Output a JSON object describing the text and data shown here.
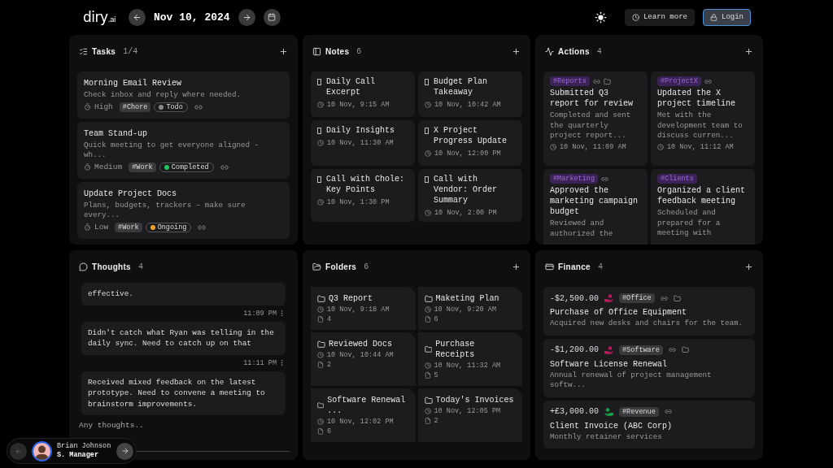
{
  "header": {
    "logo": "diry",
    "logo_suffix": ".ai",
    "date": "Nov 10, 2024",
    "learn_more": "Learn more",
    "login": "Login"
  },
  "tasks": {
    "title": "Tasks",
    "count": "1/4",
    "items": [
      {
        "title": "Morning Email Review",
        "description": "Check inbox and reply where needed.",
        "priority": "High",
        "tag": "#Chore",
        "status": "Todo",
        "color": "#8a8a8a"
      },
      {
        "title": "Team Stand-up",
        "description": "Quick meeting to get everyone aligned - wh...",
        "priority": "Medium",
        "tag": "#Work",
        "status": "Completed",
        "color": "#22c55e"
      },
      {
        "title": "Update Project Docs",
        "description": "Plans, budgets, trackers – make sure every...",
        "priority": "Low",
        "tag": "#Work",
        "status": "Ongoing",
        "color": "#f5a524"
      }
    ]
  },
  "notes": {
    "title": "Notes",
    "count": "6",
    "items": [
      {
        "title": "Daily Call Excerpt",
        "time": "10 Nov, 9:15 AM"
      },
      {
        "title": "Budget Plan Takeaway",
        "time": "10 Nov, 10:42 AM"
      },
      {
        "title": "Daily Insights",
        "time": "10 Nov, 11:30 AM"
      },
      {
        "title": "X Project Progress Update",
        "time": "10 Nov, 12:00 PM"
      },
      {
        "title": "Call with Chole: Key Points",
        "time": "10 Nov, 1:30 PM"
      },
      {
        "title": "Call with Vendor: Order Summary",
        "time": "10 Nov, 2:00 PM"
      }
    ]
  },
  "actions": {
    "title": "Actions",
    "count": "4",
    "items": [
      {
        "tag": "#Reports",
        "link": true,
        "folder": true,
        "title": "Submitted Q3 report for review",
        "description": "Completed and sent the quarterly project report...",
        "time": "10 Nov, 11:09 AM"
      },
      {
        "tag": "#ProjectX",
        "link": true,
        "folder": false,
        "title": "Updated the X project timeline",
        "description": "Met with the development team to discuss curren...",
        "time": "10 Nov, 11:12 AM"
      },
      {
        "tag": "#Marketing",
        "link": true,
        "folder": false,
        "title": "Approved the marketing campaign budget",
        "description": "Reviewed and authorized the"
      },
      {
        "tag": "#Clients",
        "link": false,
        "folder": false,
        "title": "Organized a client feedback meeting",
        "description": "Scheduled and prepared for a meeting with"
      }
    ]
  },
  "thoughts": {
    "title": "Thoughts",
    "count": "4",
    "items": [
      {
        "text": "effective.",
        "time": "11:09 PM"
      },
      {
        "text": "Didn't catch what Ryan was telling in the daily sync. Need to catch up on that",
        "time": "11:11 PM"
      },
      {
        "text": "Received mixed feedback on the latest prototype. Need to convene a meeting to brainstorm improvements."
      }
    ],
    "placeholder": "Any thoughts.."
  },
  "folders": {
    "title": "Folders",
    "count": "6",
    "items": [
      {
        "name": "Q3 Report",
        "time": "10 Nov, 9:18 AM",
        "files": "4"
      },
      {
        "name": "Maketing Plan",
        "time": "10 Nov, 9:20 AM",
        "files": "6"
      },
      {
        "name": "Reviewed Docs",
        "time": "10 Nov, 10:44 AM",
        "files": "2"
      },
      {
        "name": "Purchase Receipts",
        "time": "10 Nov, 11:32 AM",
        "files": "5"
      },
      {
        "name": "Software Renewal ...",
        "time": "10 Nov, 12:02 PM",
        "files": "6"
      },
      {
        "name": "Today's Invoices",
        "time": "10 Nov, 12:05 PM",
        "files": "2"
      }
    ]
  },
  "finance": {
    "title": "Finance",
    "count": "4",
    "items": [
      {
        "amount": "-$2,500.00",
        "kind": "expense",
        "color": "#be185d",
        "tag": "#Office",
        "folder": true,
        "title": "Purchase of Office Equipment",
        "description": "Acquired new desks and chairs for the team."
      },
      {
        "amount": "-$1,200.00",
        "kind": "expense",
        "color": "#be185d",
        "tag": "#Software",
        "folder": true,
        "title": "Software License Renewal",
        "description": "Annual renewal of project management softw..."
      },
      {
        "amount": "+£3,000.00",
        "kind": "income",
        "color": "#16a34a",
        "tag": "#Revenue",
        "folder": false,
        "title": "Client Invoice (ABC Corp)",
        "description": "Monthly retainer services"
      }
    ]
  },
  "user": {
    "name": "Brian Johnson",
    "role": "S. Manager"
  }
}
